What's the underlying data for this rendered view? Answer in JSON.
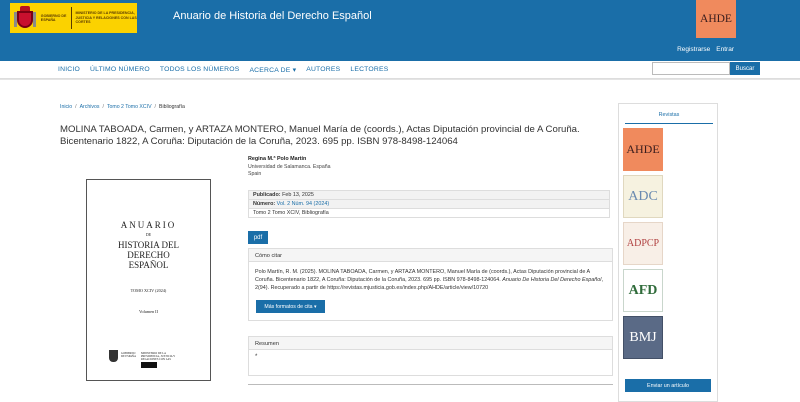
{
  "header": {
    "gov_text_1": "GOBIERNO DE ESPAÑA",
    "gov_text_2": "MINISTERIO DE LA PRESIDENCIA, JUSTICIA Y RELACIONES CON LAS CORTES",
    "site_title": "Anuario de Historia del Derecho Español",
    "logo_text": "AHDE",
    "register": "Registrarse",
    "login": "Entrar"
  },
  "nav": {
    "items": [
      "INICIO",
      "ÚLTIMO NÚMERO",
      "TODOS LOS NÚMEROS",
      "ACERCA DE ▾",
      "AUTORES",
      "LECTORES"
    ],
    "search_button": "Buscar",
    "search_value": ""
  },
  "breadcrumb": {
    "home": "Inicio",
    "archives": "Archivos",
    "issue": "Tomo 2 Tomo XCIV",
    "current": "Bibliografía"
  },
  "article": {
    "title": "MOLINA TABOADA, Carmen, y ARTAZA MONTERO, Manuel María de (coords.), Actas Diputación provincial de A Coruña. Bicentenario 1822, A Coruña: Diputación de la Coruña, 2023. 695 pp. ISBN 978-8498-124064",
    "author": "Regina M.ª Polo Martín",
    "affiliation": "Universidad de Salamanca. España",
    "country": "Spain",
    "published_label": "Publicado:",
    "published_value": "Feb 13, 2025",
    "issue_label": "Número:",
    "issue_value": "Vol. 2 Núm. 94 (2024)",
    "section": "Tomo 2 Tomo XCIV, Bibliografía",
    "pdf_label": "pdf"
  },
  "cite": {
    "heading": "Cómo citar",
    "text_main": "Polo Martín, R. M. (2025). MOLINA TABOADA, Carmen, y ARTAZA MONTERO, Manuel María de (coords.), Actas Diputación provincial de A Coruña. Bicentenario 1822, A Coruña: Diputación de la Coruña, 2023. 695 pp. ISBN 978-8498-124064. ",
    "text_journal": "Anuario De Historia Del Derecho Español",
    "text_tail": ", 2(94). Recuperado a partir de https://revistas.mjusticia.gob.es/index.php/AHDE/article/view/10720",
    "more_formats": "Más formatos de cita ▾"
  },
  "abstract": {
    "heading": "Resumen",
    "text": "*"
  },
  "cover": {
    "anuario": "ANUARIO",
    "de": "DE",
    "line1": "HISTORIA DEL",
    "line2": "DERECHO",
    "line3": "ESPAÑOL",
    "tomo": "TOMO XCIV (2024)",
    "volume": "Volumen II",
    "footer_gov": "GOBIERNO DE ESPAÑA",
    "footer_min": "MINISTERIO DE LA PRESIDENCIA, JUSTICIA Y RELACIONES CON LAS CORTES"
  },
  "sidebar": {
    "title": "Revistas",
    "journals": [
      "AHDE",
      "ADC",
      "ADPCP",
      "AFD",
      "BMJ"
    ],
    "submit": "Enviar un artículo"
  },
  "colors": {
    "primary": "#1a6ea8",
    "gov_yellow": "#fbd200",
    "ahde_orange": "#f08a5d"
  }
}
